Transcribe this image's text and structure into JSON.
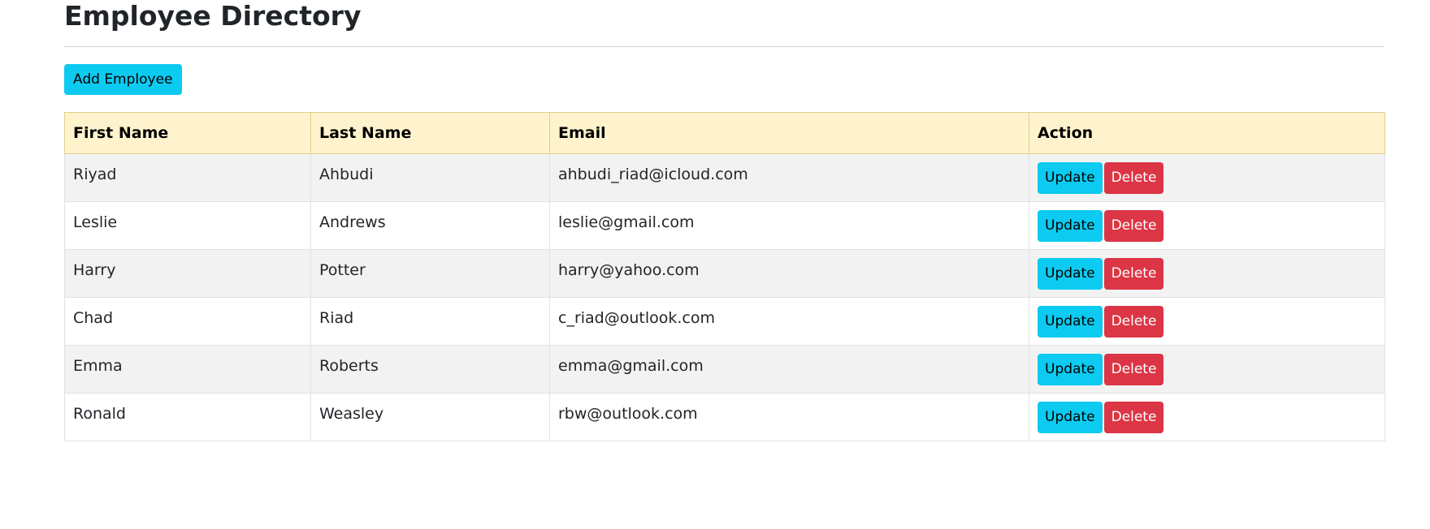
{
  "page": {
    "title": "Employee Directory"
  },
  "toolbar": {
    "add_label": "Add Employee"
  },
  "colors": {
    "info": "#0dcaf0",
    "danger": "#dc3545",
    "header_bg": "#fff3cd",
    "stripe_bg": "#f2f2f2"
  },
  "table": {
    "columns": [
      "First Name",
      "Last Name",
      "Email",
      "Action"
    ],
    "update_label": "Update",
    "delete_label": "Delete",
    "rows": [
      {
        "first": "Riyad",
        "last": "Ahbudi",
        "email": "ahbudi_riad@icloud.com"
      },
      {
        "first": "Leslie",
        "last": "Andrews",
        "email": "leslie@gmail.com"
      },
      {
        "first": "Harry",
        "last": "Potter",
        "email": "harry@yahoo.com"
      },
      {
        "first": "Chad",
        "last": "Riad",
        "email": "c_riad@outlook.com"
      },
      {
        "first": "Emma",
        "last": "Roberts",
        "email": "emma@gmail.com"
      },
      {
        "first": "Ronald",
        "last": "Weasley",
        "email": "rbw@outlook.com"
      }
    ]
  }
}
